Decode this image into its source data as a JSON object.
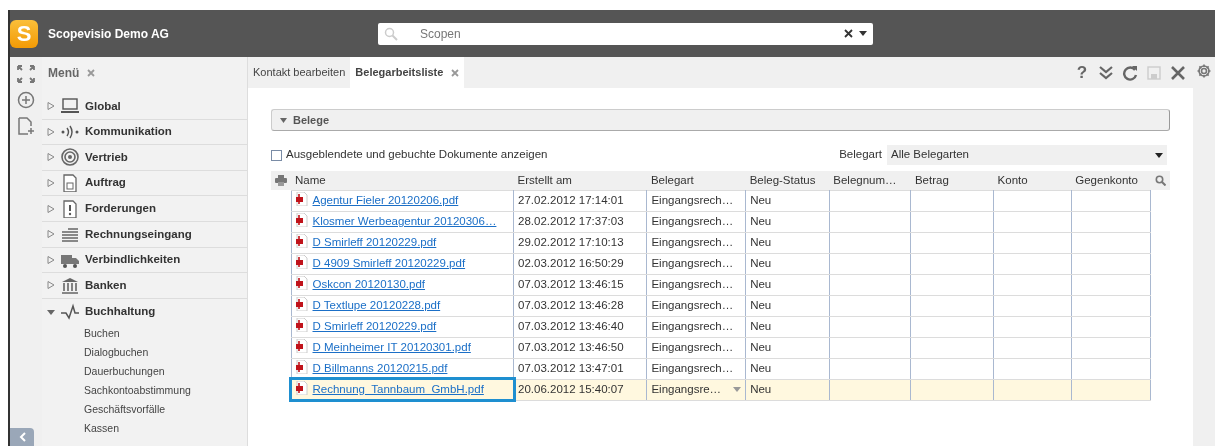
{
  "app": {
    "logo": "S",
    "title": "Scopevisio Demo AG"
  },
  "search": {
    "placeholder": "Scopen"
  },
  "rail": [
    {
      "kind": "expand"
    },
    {
      "kind": "add"
    },
    {
      "kind": "new-doc"
    }
  ],
  "menu_tab": {
    "label": "Menü",
    "selected": true
  },
  "menu": [
    {
      "label": "Global",
      "expanded": false
    },
    {
      "label": "Kommunikation",
      "expanded": false
    },
    {
      "label": "Vertrieb",
      "expanded": false
    },
    {
      "label": "Auftrag",
      "expanded": false
    },
    {
      "label": "Forderungen",
      "expanded": false
    },
    {
      "label": "Rechnungseingang",
      "expanded": false
    },
    {
      "label": "Verbindlichkeiten",
      "expanded": false
    },
    {
      "label": "Banken",
      "expanded": false
    },
    {
      "label": "Buchhaltung",
      "expanded": true,
      "children": [
        {
          "label": "Buchen"
        },
        {
          "label": "Dialogbuchen"
        },
        {
          "label": "Dauerbuchungen"
        },
        {
          "label": "Sachkontoabstimmung"
        },
        {
          "label": "Geschäftsvorfälle"
        },
        {
          "label": "Kassen"
        }
      ]
    }
  ],
  "tabs": [
    {
      "label": "Kontakt bearbeiten",
      "selected": false,
      "closable": false
    },
    {
      "label": "Belegarbeitsliste",
      "selected": true,
      "closable": true
    }
  ],
  "toolbar": [
    {
      "kind": "help",
      "label": "?",
      "disabled": false
    },
    {
      "kind": "collapse-all",
      "disabled": false
    },
    {
      "kind": "refresh",
      "disabled": false
    },
    {
      "kind": "save",
      "disabled": true
    },
    {
      "kind": "close",
      "disabled": false
    }
  ],
  "panel": {
    "title": "Belege",
    "expanded": true
  },
  "filter": {
    "checkbox_label": "Ausgeblendete und gebuchte Dokumente anzeigen",
    "checked": false,
    "belegart_label": "Belegart",
    "belegart_value": "Alle Belegarten"
  },
  "table": {
    "columns": [
      "Name",
      "Erstellt am",
      "Belegart",
      "Beleg-Status",
      "Belegnum…",
      "Betrag",
      "Konto",
      "Gegenkonto"
    ],
    "rows": [
      {
        "cells": [
          "Agentur Fieler 20120206.pdf",
          "27.02.2012 17:14:01",
          "Eingangsrech…",
          "Neu"
        ],
        "selected": false
      },
      {
        "cells": [
          "Klosmer Werbeagentur 20120306…",
          "28.02.2012 17:37:03",
          "Eingangsrech…",
          "Neu"
        ],
        "selected": false
      },
      {
        "cells": [
          "D Smirleff 20120229.pdf",
          "29.02.2012 17:10:13",
          "Eingangsrech…",
          "Neu"
        ],
        "selected": false
      },
      {
        "cells": [
          "D 4909 Smirleff 20120229.pdf",
          "02.03.2012 16:50:29",
          "Eingangsrech…",
          "Neu"
        ],
        "selected": false
      },
      {
        "cells": [
          "Oskcon 20120130.pdf",
          "07.03.2012 13:46:15",
          "Eingangsrech…",
          "Neu"
        ],
        "selected": false
      },
      {
        "cells": [
          "D Textlupe 20120228.pdf",
          "07.03.2012 13:46:28",
          "Eingangsrech…",
          "Neu"
        ],
        "selected": false
      },
      {
        "cells": [
          "D Smirleff 20120229.pdf",
          "07.03.2012 13:46:40",
          "Eingangsrech…",
          "Neu"
        ],
        "selected": false
      },
      {
        "cells": [
          "D Meinheimer IT 20120301.pdf",
          "07.03.2012 13:46:50",
          "Eingangsrech…",
          "Neu"
        ],
        "selected": false
      },
      {
        "cells": [
          "D Billmanns 20120215.pdf",
          "07.03.2012 13:47:01",
          "Eingangsrech…",
          "Neu"
        ],
        "selected": false
      },
      {
        "cells": [
          "Rechnung_Tannbaum_GmbH.pdf",
          "20.06.2012 15:40:07",
          "Eingangsre…",
          "Neu"
        ],
        "selected": true
      }
    ]
  }
}
